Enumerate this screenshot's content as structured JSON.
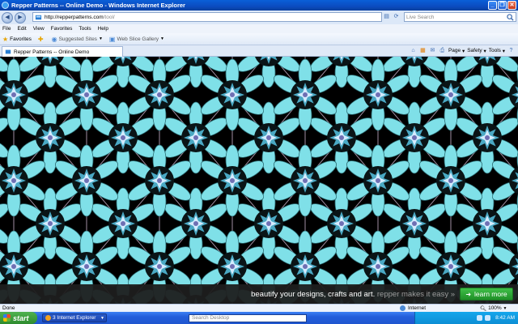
{
  "window": {
    "title": "Repper Patterns -- Online Demo - Windows Internet Explorer"
  },
  "address": {
    "url_host": "http://repperpatterns.com",
    "url_path": "/tool/"
  },
  "livesearch": {
    "placeholder": "Live Search"
  },
  "menu": [
    "File",
    "Edit",
    "View",
    "Favorites",
    "Tools",
    "Help"
  ],
  "favorites": {
    "label": "Favorites",
    "suggested": "Suggested Sites",
    "webslice": "Web Slice Gallery"
  },
  "tab": {
    "label": "Repper Patterns -- Online Demo"
  },
  "commandbar": {
    "page": "Page",
    "safety": "Safety",
    "tools": "Tools"
  },
  "promo": {
    "tagline_main": "beautify your designs, crafts and art.",
    "tagline_brand": "repper makes it easy »",
    "button": "learn more"
  },
  "status": {
    "text": "Done",
    "zone": "Internet",
    "zoom": "100%"
  },
  "taskbar": {
    "start": "start",
    "task": "3 Internet Explorer",
    "search_placeholder": "Search Desktop",
    "clock": "8:42 AM"
  },
  "colors": {
    "pattern_primary": "#6fd3dc",
    "pattern_dark": "#1e3a3f",
    "accent_green": "#2a9f32"
  }
}
